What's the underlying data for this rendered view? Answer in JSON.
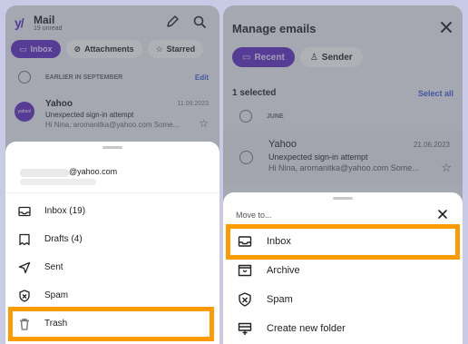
{
  "left": {
    "header": {
      "logo": "y/",
      "title": "Mail",
      "unread": "19 unread",
      "edit_icon": "pencil-icon",
      "search_icon": "search-icon"
    },
    "chips": [
      {
        "label": "Inbox",
        "icon": "inbox-icon",
        "active": true
      },
      {
        "label": "Attachments",
        "icon": "paperclip-icon",
        "active": false
      },
      {
        "label": "Starred",
        "icon": "star-icon",
        "active": false
      }
    ],
    "section": {
      "label": "EARLIER IN SEPTEMBER",
      "action": "Edit"
    },
    "message": {
      "avatar_text": "yahoo!",
      "from": "Yahoo",
      "date": "11.09.2023",
      "subject": "Unexpected sign-in attempt",
      "preview": "Hi Nina, aromanitka@yahoo.com Some..."
    },
    "sheet": {
      "account": "@yahoo.com",
      "folders": [
        {
          "label": "Inbox (19)",
          "icon": "inbox-icon"
        },
        {
          "label": "Drafts (4)",
          "icon": "draft-icon"
        },
        {
          "label": "Sent",
          "icon": "send-icon"
        },
        {
          "label": "Spam",
          "icon": "spam-icon"
        },
        {
          "label": "Trash",
          "icon": "trash-icon",
          "highlighted": true
        }
      ]
    }
  },
  "right": {
    "title": "Manage emails",
    "chips": [
      {
        "label": "Recent",
        "icon": "inbox-icon",
        "active": true
      },
      {
        "label": "Sender",
        "icon": "people-icon",
        "active": false
      }
    ],
    "selected": "1 selected",
    "select_all": "Select all",
    "month": "JUNE",
    "message": {
      "from": "Yahoo",
      "date": "21.06.2023",
      "subject": "Unexpected sign-in attempt",
      "preview": "Hi Nina, aromanitka@yahoo.com Some..."
    },
    "move_sheet": {
      "title": "Move to...",
      "folders": [
        {
          "label": "Inbox",
          "icon": "inbox-icon",
          "highlighted": true
        },
        {
          "label": "Archive",
          "icon": "archive-icon"
        },
        {
          "label": "Spam",
          "icon": "spam-icon"
        },
        {
          "label": "Create new folder",
          "icon": "new-folder-icon"
        }
      ]
    }
  },
  "colors": {
    "accent": "#5b2bbf",
    "highlight": "#ff9a00",
    "link": "#3a5bd9"
  }
}
